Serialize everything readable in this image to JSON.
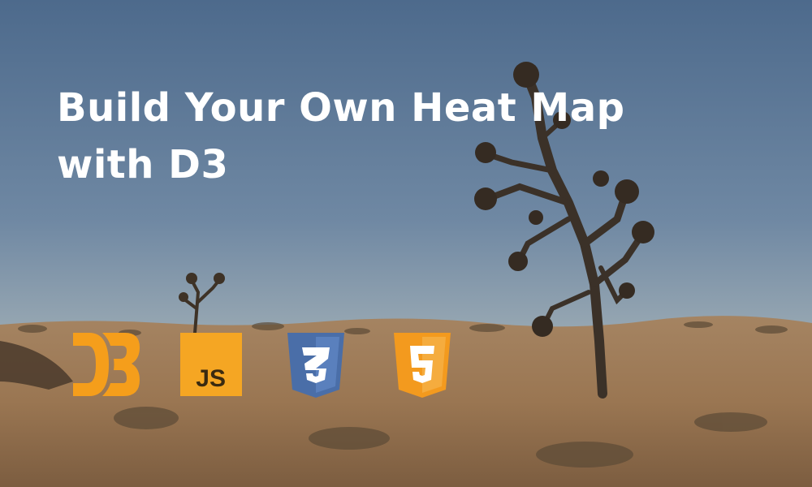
{
  "hero": {
    "title_line1": "Build Your Own Heat Map",
    "title_line2": "with D3"
  },
  "logos": [
    {
      "name": "d3-logo",
      "label": "D3",
      "color": "#f59e1b"
    },
    {
      "name": "javascript-logo",
      "label": "JS",
      "color": "#f5a623",
      "text_color": "#3a2a10"
    },
    {
      "name": "css3-logo",
      "label": "3",
      "color": "#4a6ea8"
    },
    {
      "name": "html5-logo",
      "label": "5",
      "color": "#f39a1e"
    }
  ],
  "colors": {
    "sky_top": "#4f6c8d",
    "sky_bottom": "#8aa0b5",
    "ground": "#9b7a56",
    "tree": "#3b3128"
  }
}
